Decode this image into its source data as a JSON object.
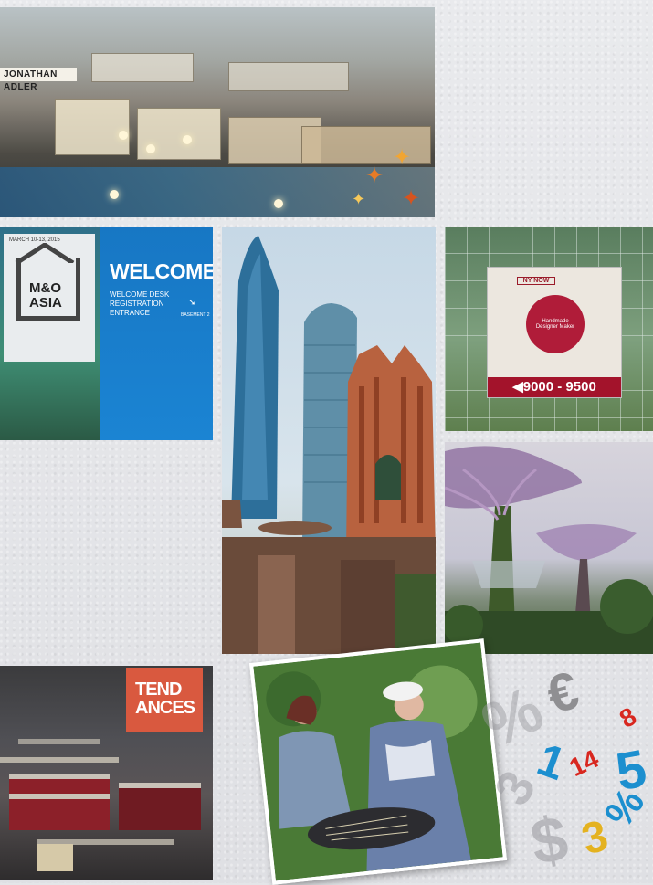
{
  "photos": {
    "hall": {
      "sign": "JONATHAN ADLER"
    },
    "welcome": {
      "date": "MARCH 10-13, 2015",
      "logo_line1": "M&O",
      "logo_line2": "ASIA",
      "headline": "WELCOME",
      "sub1": "WELCOME DESK",
      "sub2": "REGISTRATION",
      "sub3": "ENTRANCE",
      "base": "BASEMENT 2"
    },
    "nynow": {
      "logo": "NY NOW",
      "circle_line1": "Handmade",
      "circle_line2": "Designer Maker",
      "range": "9000 - 9500"
    },
    "store": {
      "banner_line1": "TEND",
      "banner_line2": "ANCES"
    }
  },
  "decor": {
    "symbols": [
      "%",
      "€",
      "1",
      "14",
      "5",
      "3",
      "%",
      "$",
      "8",
      "3"
    ]
  },
  "colors": {
    "background": "#e4e5e8",
    "accent_blue": "#1b84d3",
    "accent_red": "#a3132b"
  }
}
